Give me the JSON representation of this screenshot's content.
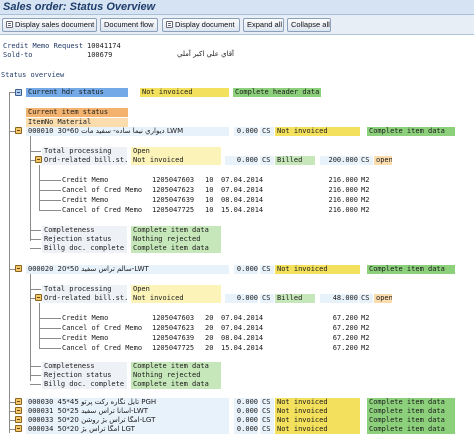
{
  "window": {
    "title": "Sales order: Status Overview"
  },
  "toolbar": [
    {
      "label": "Display sales document",
      "icon": "document-icon"
    },
    {
      "label": "Document flow",
      "icon": ""
    },
    {
      "label": "Display document",
      "icon": "document-icon"
    },
    {
      "label": "Expand all",
      "icon": ""
    },
    {
      "label": "Collapse all",
      "icon": ""
    }
  ],
  "header": {
    "doc_label": "Credit Memo Request",
    "doc_number": "10041174",
    "sold_to_label": "Sold-to",
    "sold_to_number": "100679",
    "customer_name": "آقاي علي اكبر آملي"
  },
  "status_overview": {
    "title": "Status overview",
    "header_row": {
      "label": "Current hdr status",
      "status": "Not invoiced",
      "detail": "Complete header data"
    },
    "col_current_item": "Current item status",
    "col_item_material": "ItemNo Material",
    "items": [
      {
        "number": "000010",
        "material": "30*60 ديواري نيما ساده- سفيد مات LWM",
        "qty": "0.000",
        "uom": "CS",
        "status": "Not invoiced",
        "detail": "Complete item data",
        "total_processing_label": "Total processing",
        "total_processing": "Open",
        "billing_label": "Ord-related bill.st.",
        "billing_status": "Not invoiced",
        "billing_qty": "0.000",
        "billing_uom": "CS",
        "billing_flow": "Billed",
        "billing_open_qty": "200.000",
        "billing_open_uom": "CS",
        "billing_open": "open",
        "docs": [
          {
            "type": "Credit Memo",
            "number": "1205047603",
            "item": "10",
            "date": "07.04.2014",
            "qty": "216.000",
            "uom": "M2"
          },
          {
            "type": "Cancel of Cred Memo",
            "number": "1205047623",
            "item": "10",
            "date": "07.04.2014",
            "qty": "216.000",
            "uom": "M2"
          },
          {
            "type": "Credit Memo",
            "number": "1205047639",
            "item": "10",
            "date": "08.04.2014",
            "qty": "216.000",
            "uom": "M2"
          },
          {
            "type": "Cancel of Cred Memo",
            "number": "1205047725",
            "item": "10",
            "date": "15.04.2014",
            "qty": "216.000",
            "uom": "M2"
          }
        ],
        "summary": [
          {
            "label": "Completeness",
            "value": "Complete item data"
          },
          {
            "label": "Rejection status",
            "value": "Nothing rejected"
          },
          {
            "label": "Billg doc. complete",
            "value": "Complete item data"
          }
        ]
      },
      {
        "number": "000020",
        "material": "20*50 سالم تراس سفيد-LWT",
        "qty": "0.000",
        "uom": "CS",
        "status": "Not invoiced",
        "detail": "Complete item data",
        "total_processing_label": "Total processing",
        "total_processing": "Open",
        "billing_label": "Ord-related bill.st.",
        "billing_status": "Not invoiced",
        "billing_qty": "0.000",
        "billing_uom": "CS",
        "billing_flow": "Billed",
        "billing_open_qty": "48.000",
        "billing_open_uom": "CS",
        "billing_open": "open",
        "docs": [
          {
            "type": "Credit Memo",
            "number": "1205047603",
            "item": "20",
            "date": "07.04.2014",
            "qty": "67.200",
            "uom": "M2"
          },
          {
            "type": "Cancel of Cred Memo",
            "number": "1205047623",
            "item": "20",
            "date": "07.04.2014",
            "qty": "67.200",
            "uom": "M2"
          },
          {
            "type": "Credit Memo",
            "number": "1205047639",
            "item": "20",
            "date": "08.04.2014",
            "qty": "67.200",
            "uom": "M2"
          },
          {
            "type": "Cancel of Cred Memo",
            "number": "1205047725",
            "item": "20",
            "date": "15.04.2014",
            "qty": "67.200",
            "uom": "M2"
          }
        ],
        "summary": [
          {
            "label": "Completeness",
            "value": "Complete item data"
          },
          {
            "label": "Rejection status",
            "value": "Nothing rejected"
          },
          {
            "label": "Billg doc. complete",
            "value": "Complete item data"
          }
        ]
      }
    ],
    "collapsed_items": [
      {
        "number": "000030",
        "material": "45*45 تايل نگاره ركت پرتو PGH",
        "qty": "0.000",
        "uom": "CS",
        "status": "Not invoiced",
        "detail": "Complete item data"
      },
      {
        "number": "000031",
        "material": "50*25 اسانا تراس سفيد-LWT",
        "qty": "0.000",
        "uom": "CS",
        "status": "Not invoiced",
        "detail": "Complete item data"
      },
      {
        "number": "000033",
        "material": "50*20 امگا تراس بژ روشن-LGT",
        "qty": "0.000",
        "uom": "CS",
        "status": "Not invoiced",
        "detail": "Complete item data"
      },
      {
        "number": "000034",
        "material": "50*20 امگا تراس بژ LGT",
        "qty": "0.000",
        "uom": "CS",
        "status": "Not invoiced",
        "detail": "Complete item data"
      }
    ]
  },
  "colors": {
    "title_bar": "#d5e3f2",
    "status_blue": "#72a9e6",
    "status_yellow": "#f3e05c",
    "status_green": "#8dd07c",
    "status_orange": "#f3b36e",
    "tree_node": "#f4c86a"
  }
}
